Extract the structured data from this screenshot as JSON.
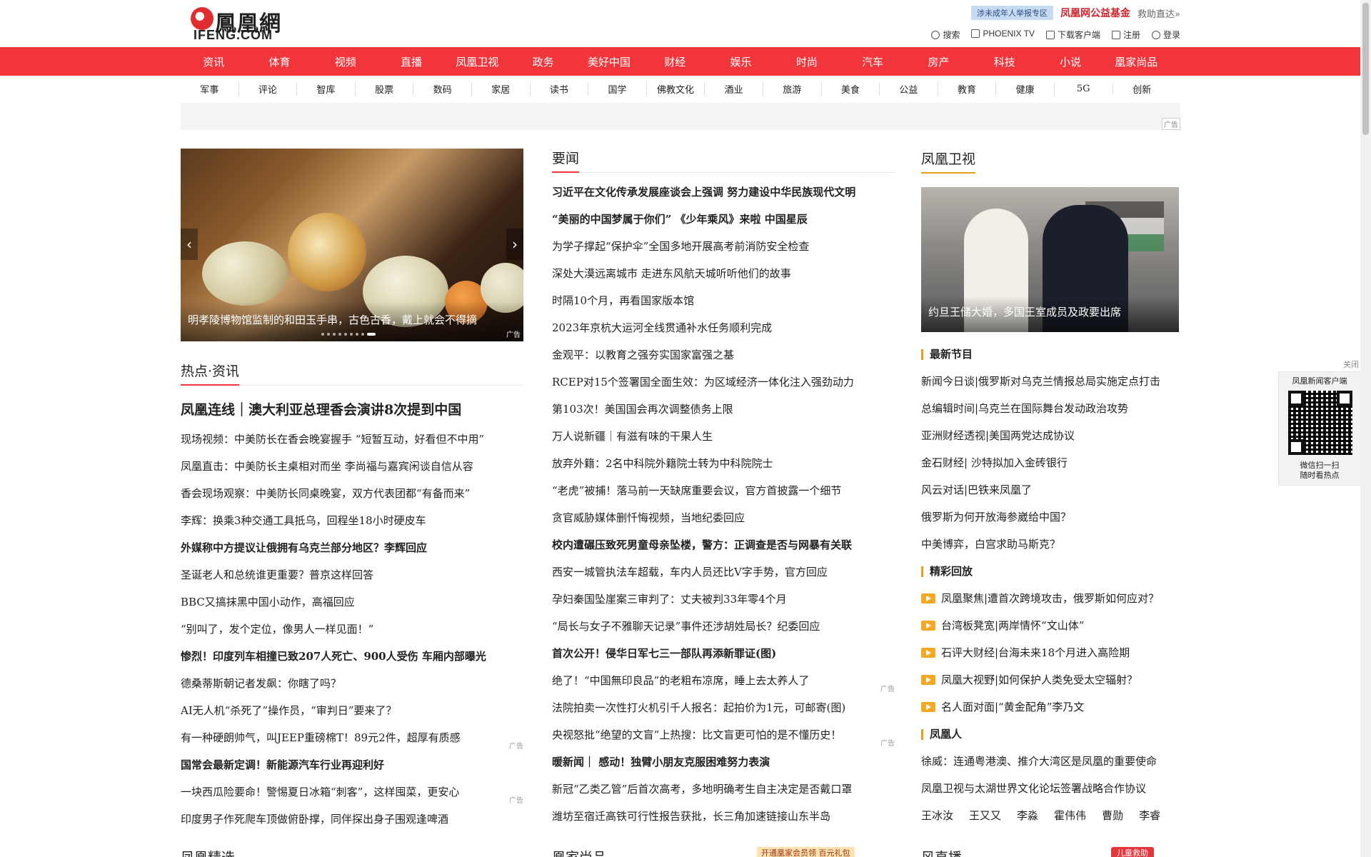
{
  "header": {
    "logo_cn": "鳳凰網",
    "logo_en": "IFENG.COM",
    "minor_report": "涉未成年人举报专区",
    "charity": "凤凰网公益基金",
    "rescue": "救助直达»",
    "utils": [
      "搜索",
      "PHOENIX TV",
      "下载客户端",
      "注册",
      "登录"
    ]
  },
  "main_nav": [
    "资讯",
    "体育",
    "视频",
    "直播",
    "凤凰卫视",
    "政务",
    "美好中国",
    "财经",
    "娱乐",
    "时尚",
    "汽车",
    "房产",
    "科技",
    "小说",
    "凰家尚品"
  ],
  "sub_nav": [
    "军事",
    "评论",
    "智库",
    "股票",
    "数码",
    "家居",
    "读书",
    "国学",
    "佛教文化",
    "酒业",
    "旅游",
    "美食",
    "公益",
    "教育",
    "健康",
    "5G",
    "创新"
  ],
  "ad_label": "广告",
  "slider": {
    "caption": "明孝陵博物馆监制的和田玉手串，古色古香，戴上就会不得摘",
    "ad": "广告",
    "prev": "‹",
    "next": "›"
  },
  "hot": {
    "title": "热点·资讯",
    "headline": "凤凰连线｜澳大利亚总理香会演讲8次提到中国",
    "items": [
      {
        "text": "现场视频：中美防长在香会晚宴握手 “短暂互动，好看但不中用”",
        "bold": false,
        "ad": false
      },
      {
        "text": "凤凰直击：中美防长主桌相对而坐 李尚福与嘉宾闲谈自信从容",
        "bold": false,
        "ad": false
      },
      {
        "text": "香会现场观察：中美防长同桌晚宴，双方代表团都“有备而来”",
        "bold": false,
        "ad": false
      },
      {
        "text": "李辉：换乘3种交通工具抵乌，回程坐18小时硬皮车",
        "bold": false,
        "ad": false
      },
      {
        "text": "外媒称中方提议让俄拥有乌克兰部分地区？李辉回应",
        "bold": true,
        "ad": false
      },
      {
        "text": "圣诞老人和总统谁更重要？普京这样回答",
        "bold": false,
        "ad": false
      },
      {
        "text": "BBC又搞抹黑中国小动作，高福回应",
        "bold": false,
        "ad": false
      },
      {
        "text": "“别叫了，发个定位，像男人一样见面！”",
        "bold": false,
        "ad": false
      },
      {
        "text": "惨烈！印度列车相撞已致207人死亡、900人受伤 车厢内部曝光",
        "bold": true,
        "ad": false
      },
      {
        "text": "德桑蒂斯朝记者发飙：你瞎了吗？",
        "bold": false,
        "ad": false
      },
      {
        "text": "AI无人机“杀死了”操作员，“审判日”要来了？",
        "bold": false,
        "ad": false
      },
      {
        "text": "有一种硬朗帅气，叫JEEP重磅棉T！89元2件，超厚有质感",
        "bold": false,
        "ad": true
      },
      {
        "text": "国常会最新定调！新能源汽车行业再迎利好",
        "bold": true,
        "ad": false
      },
      {
        "text": "一块西瓜险要命！警惕夏日冰箱“刺客”，这样囤菜，更安心",
        "bold": false,
        "ad": true
      },
      {
        "text": "印度男子作死爬车顶做俯卧撑，同伴探出身子围观逢啤酒",
        "bold": false,
        "ad": false
      }
    ]
  },
  "news": {
    "title": "要闻",
    "items": [
      {
        "text": "习近平在文化传承发展座谈会上强调 努力建设中华民族现代文明",
        "bold": true,
        "ad": false
      },
      {
        "text": "“美丽的中国梦属于你们” 《少年乘风》来啦 中国星辰",
        "bold": true,
        "ad": false
      },
      {
        "text": "为学子撑起“保护伞”全国多地开展高考前消防安全检查",
        "bold": false,
        "ad": false
      },
      {
        "text": "深处大漠远离城市 走进东风航天城听听他们的故事",
        "bold": false,
        "ad": false
      },
      {
        "text": "时隔10个月，再看国家版本馆",
        "bold": false,
        "ad": false
      },
      {
        "text": "2023年京杭大运河全线贯通补水任务顺利完成",
        "bold": false,
        "ad": false
      },
      {
        "text": "金观平：以教育之强夯实国家富强之基",
        "bold": false,
        "ad": false
      },
      {
        "text": "RCEP对15个签署国全面生效：为区域经济一体化注入强劲动力",
        "bold": false,
        "ad": false
      },
      {
        "text": "第103次！美国国会再次调整债务上限",
        "bold": false,
        "ad": false
      },
      {
        "text": "万人说新疆｜有滋有味的干果人生",
        "bold": false,
        "ad": false
      },
      {
        "text": "放弃外籍：2名中科院外籍院士转为中科院院士",
        "bold": false,
        "ad": false
      },
      {
        "text": "“老虎”被捕！落马前一天缺席重要会议，官方首披露一个细节",
        "bold": false,
        "ad": false
      },
      {
        "text": "贪官威胁媒体删忏悔视频，当地纪委回应",
        "bold": false,
        "ad": false
      },
      {
        "text": "校内遭碾压致死男童母亲坠楼，警方：正调查是否与网暴有关联",
        "bold": true,
        "ad": false
      },
      {
        "text": "西安一城管执法车超载，车内人员还比V字手势，官方回应",
        "bold": false,
        "ad": false
      },
      {
        "text": "孕妇秦国坠崖案三审判了：丈夫被判33年零4个月",
        "bold": false,
        "ad": false
      },
      {
        "text": "“局长与女子不雅聊天记录”事件还涉胡姓局长？纪委回应",
        "bold": false,
        "ad": false
      },
      {
        "text": "首次公开！侵华日军七三一部队再添新罪证(图)",
        "bold": true,
        "ad": false
      },
      {
        "text": "绝了！“中国無印良品”的老粗布凉席，睡上去太养人了",
        "bold": false,
        "ad": true
      },
      {
        "text": "法院拍卖一次性打火机引千人报名：起拍价为1元，可邮寄(图)",
        "bold": false,
        "ad": false
      },
      {
        "text": "央视怒批“绝望的文盲”上热搜：比文盲更可怕的是不懂历史！",
        "bold": false,
        "ad": true
      },
      {
        "text": "暖新闻｜ 感动！独臂小朋友克服困难努力表演",
        "bold": true,
        "ad": false
      },
      {
        "text": "新冠“乙类乙管”后首次高考，多地明确考生自主决定是否戴口罩",
        "bold": false,
        "ad": false
      },
      {
        "text": "潍坊至宿迁高铁可行性报告获批，长三角加速链接山东半岛",
        "bold": false,
        "ad": false
      }
    ]
  },
  "tv": {
    "title": "凤凰卫视",
    "image_caption": "约旦王储大婚，多国王室成员及政要出席",
    "latest_title": "最新节目",
    "latest": [
      "新闻今日谈|俄罗斯对乌克兰情报总局实施定点打击",
      "总编辑时间|乌克兰在国际舞台发动政治攻势",
      "亚洲财经透视|美国两党达成协议",
      "金石财经| 沙特拟加入金砖银行",
      "风云对话|巴铁来凤凰了",
      "俄罗斯为何开放海参崴给中国？",
      "中美博弈，白宫求助马斯克？"
    ],
    "replay_title": "精彩回放",
    "replay": [
      "凤凰聚焦|遭首次跨境攻击，俄罗斯如何应对？",
      "台湾板凳宽|两岸情怀“文山体”",
      "石评大财经|台海未来18个月进入高险期",
      "凤凰大视野|如何保护人类免受太空辐射？",
      "名人面对面|“黄金配角”李乃文"
    ],
    "people_title": "凤凰人",
    "people": [
      "徐威：连通粤港澳、推介大湾区是凤凰的重要使命",
      "凤凰卫视与太湖世界文化论坛签署战略合作协议"
    ],
    "names": [
      "王冰汝",
      "王又又",
      "李淼",
      "霍伟伟",
      "曹勋",
      "李睿"
    ]
  },
  "qr": {
    "close": "关闭",
    "title": "凤凰新闻客户端",
    "line1": "微信扫一扫",
    "line2": "随时看热点"
  },
  "bottom": {
    "left": "凤凰精选",
    "mid": "凰家尚品",
    "mid_ribbon": "开通凰家会员领 百元礼包",
    "right": "风直播",
    "right_ribbon": "儿童救助"
  }
}
